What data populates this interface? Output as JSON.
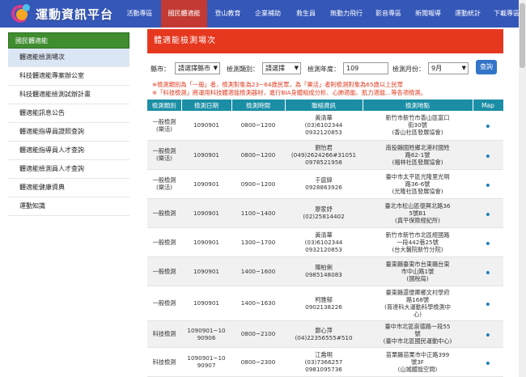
{
  "site": {
    "logo_text": "運動資訊平台"
  },
  "nav": [
    {
      "label": "活動專區"
    },
    {
      "label": "國民體適能"
    },
    {
      "label": "登山教育"
    },
    {
      "label": "企業補助"
    },
    {
      "label": "救生員"
    },
    {
      "label": "無動力飛行"
    },
    {
      "label": "影音專區"
    },
    {
      "label": "新聞報導"
    },
    {
      "label": "運動統計"
    },
    {
      "label": "下載專區"
    }
  ],
  "sidebar": {
    "header": "國民體適能",
    "items": [
      {
        "label": "體適能檢測場次"
      },
      {
        "label": "科技體適能專案辦公室"
      },
      {
        "label": "科技體適能檢測試辦計畫"
      },
      {
        "label": "體適能訊息公告"
      },
      {
        "label": "體適能指導員證照查詢"
      },
      {
        "label": "體適能指導員人才查詢"
      },
      {
        "label": "體適能檢測員人才查詢"
      },
      {
        "label": "體適能健康資典"
      },
      {
        "label": "運動知識"
      }
    ]
  },
  "main": {
    "title": "體適能檢測場次",
    "filters": {
      "city_label": "縣市：",
      "city_value": "請選擇縣市",
      "type_label": "檢測類別：",
      "type_value": "請選擇",
      "year_label": "檢測年度：",
      "year_value": "109",
      "month_label": "檢測月份：",
      "month_value": "9月",
      "query_label": "查詢"
    },
    "notes": [
      "※檢測類別為「一般」者，檢測對象為23~64歲民眾，為「樂活」者則檢測對象為65歲以上民眾",
      "※「科技檢測」將運用科技體適能檢測器材，進行BIA身體組成分析、心肺適能、肌力適能...等各項檢測。"
    ],
    "table": {
      "headers": [
        "檢測類別",
        "檢測日期",
        "檢測時間",
        "聯絡資訊",
        "檢測地點",
        "Map"
      ],
      "rows": [
        {
          "type": "一般檢測\n(樂活)",
          "date": "1090901",
          "time": "0800~1200",
          "contact": "黃清華\n(03)6102344\n0932120853",
          "location": "新竹市新竹市香山區富口\n街30號\n(香山社區發展協會)"
        },
        {
          "type": "一般檢測\n(樂活)",
          "date": "1090901",
          "time": "0800~1200",
          "contact": "劉怡君\n(049)2624266#31051\n0978521958",
          "location": "南投縣國姓鄉北港村國姓\n路62-1號\n(福林社區發展協會)"
        },
        {
          "type": "一般檢測\n(樂活)",
          "date": "1090901",
          "time": "0900~1200",
          "contact": "于庭緯\n0928863926",
          "location": "臺中市太平區光隆里光明\n路36-6號\n(光隆社區發展協會)"
        },
        {
          "type": "一般檢測",
          "date": "1090901",
          "time": "1100~1400",
          "contact": "廖家妤\n(02)25814402",
          "location": "臺北市松山區復興北路36\n5號B1\n(真平保險經紀所)"
        },
        {
          "type": "一般檢測",
          "date": "1090901",
          "time": "1300~1700",
          "contact": "黃清華\n(03)6102344\n0932120853",
          "location": "新竹市新竹市北區經國路\n一段442巷25號\n(台大醫院新竹分院)"
        },
        {
          "type": "一般檢測",
          "date": "1090901",
          "time": "1400~1600",
          "contact": "陳柏俐\n0985148083",
          "location": "臺東縣臺東市台東縣台東\n市中山路1號\n(國稅局)"
        },
        {
          "type": "一般檢測",
          "date": "1090901",
          "time": "1400~1630",
          "contact": "柯雅郁\n0902138226",
          "location": "臺東縣還便卿鄉文村學府\n路168號\n(育達科大運動科學檢測中\n心)"
        },
        {
          "type": "科技檢測",
          "date": "1090901~10\n90906",
          "time": "0800~2100",
          "contact": "鄭心萍\n(04)22356555#510",
          "location": "臺中市北區崇德路一段55\n號\n(臺中市北區國民運動中心)"
        },
        {
          "type": "科技檢測",
          "date": "1090901~10\n90907",
          "time": "0800~2300",
          "contact": "江喬明\n(03)7366257\n0981095736",
          "location": "苗栗縣苗栗市中正路399\n號3F\n(山城體能空間)"
        }
      ]
    }
  },
  "icons": {
    "map_pin": "map-pin-icon"
  },
  "colors": {
    "header": "#3457b8",
    "nav_active": "#c23a33",
    "title_bar": "#e5381f",
    "sidebar_header": "#3f8d2f",
    "table_header": "#1b8ea6"
  }
}
